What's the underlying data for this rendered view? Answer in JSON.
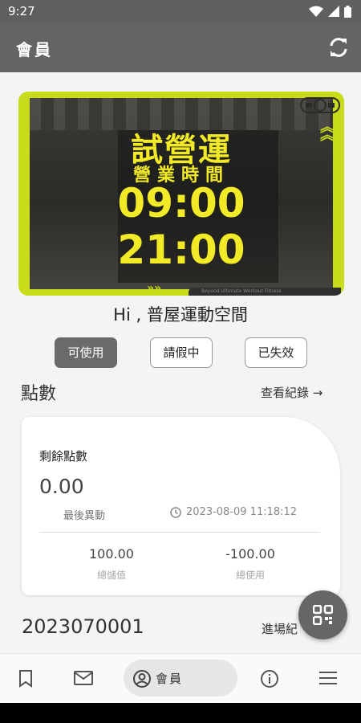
{
  "status_bar": {
    "time": "9:27"
  },
  "app_bar": {
    "title": "會員",
    "refresh_icon": "refresh-icon"
  },
  "banner": {
    "line1": "試營運",
    "line2": "營業時間",
    "open_time": "09:00",
    "close_time": "21:00",
    "tagline": "Beyond Ultimate Workout Fitness",
    "accent_color": "#c9dc1a",
    "text_color": "#f2e927"
  },
  "greeting": "Hi , 普屋運動空間",
  "status_chips": [
    {
      "label": "可使用",
      "active": true
    },
    {
      "label": "請假中",
      "active": false
    },
    {
      "label": "已失效",
      "active": false
    }
  ],
  "points": {
    "section_title": "點數",
    "view_records_label": "查看紀錄 →",
    "remaining_label": "剩餘點數",
    "remaining_value": "0.00",
    "last_change_label": "最後異動",
    "last_change_time": "2023-08-09 11:18:12",
    "total_stored_value": "100.00",
    "total_stored_label": "總儲值",
    "total_used_value": "-100.00",
    "total_used_label": "總使用"
  },
  "entry": {
    "member_id": "2023070001",
    "entry_link_label": "進場紀"
  },
  "bottom_nav": {
    "items": [
      {
        "name": "bookmark-icon"
      },
      {
        "name": "mail-icon"
      },
      {
        "name": "account-icon",
        "label": "會員",
        "active": true
      },
      {
        "name": "info-icon"
      },
      {
        "name": "menu-icon"
      }
    ]
  },
  "colors": {
    "appbar": "#646464",
    "background": "#f4f4f6",
    "active_chip": "#6a6a6a"
  }
}
